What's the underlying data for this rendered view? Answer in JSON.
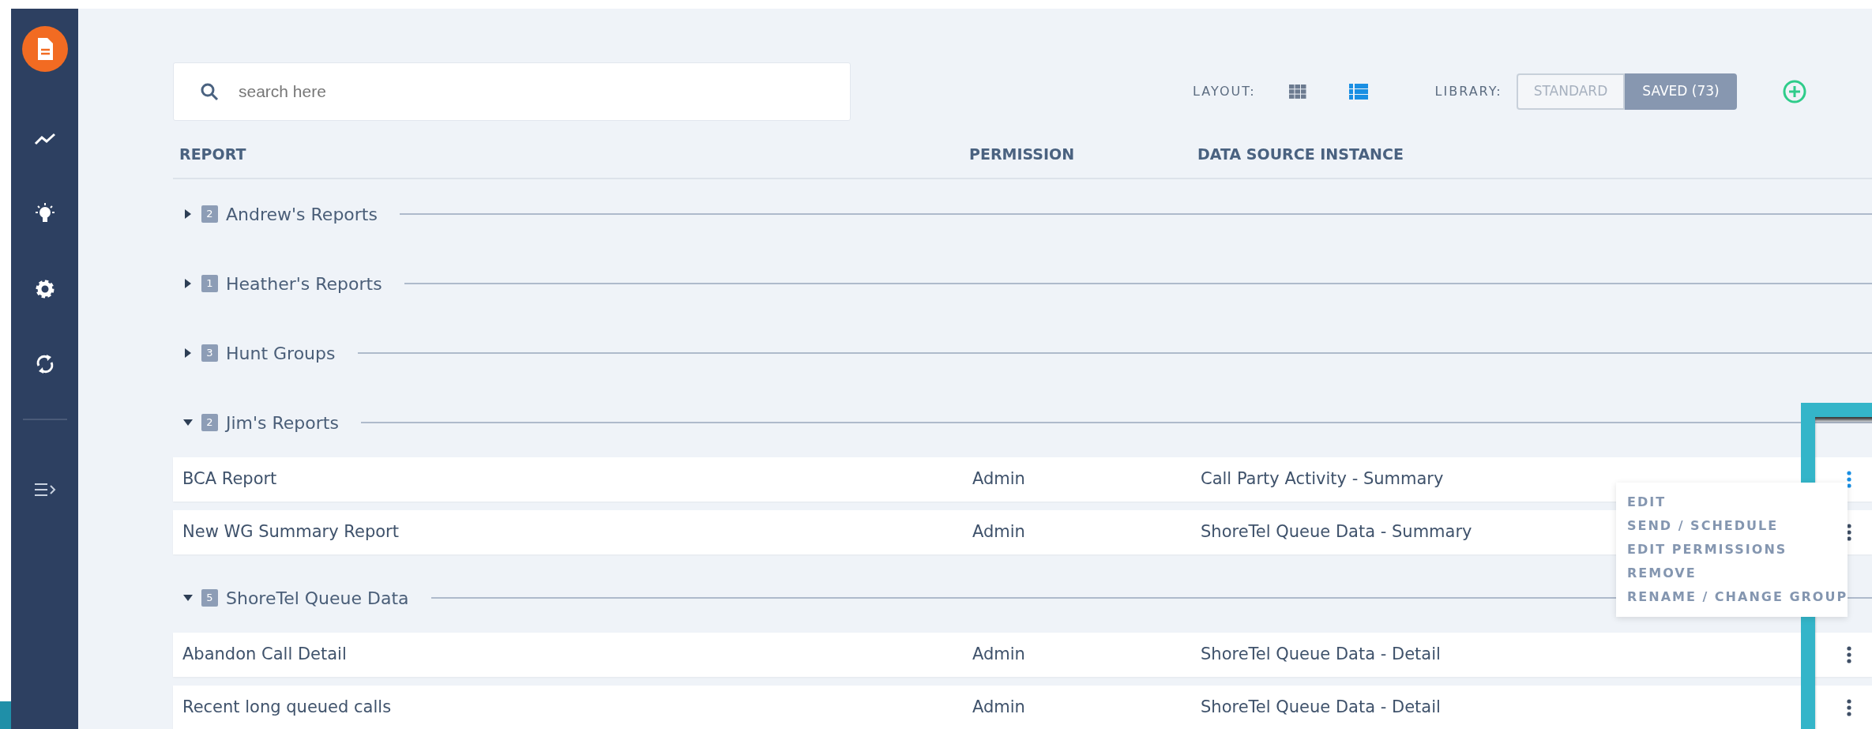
{
  "sidebar": {
    "items": [
      {
        "selected": true
      },
      {
        "selected": false
      },
      {
        "selected": false
      },
      {
        "selected": false
      },
      {
        "selected": false
      }
    ]
  },
  "search": {
    "placeholder": "search here"
  },
  "layout": {
    "label": "LAYOUT:",
    "options": [
      {
        "selected": false
      },
      {
        "selected": true
      }
    ]
  },
  "library": {
    "label": "LIBRARY:",
    "options": [
      {
        "label": "STANDARD",
        "selected": false
      },
      {
        "label": "SAVED (73)",
        "selected": true
      }
    ]
  },
  "table": {
    "columns": [
      "REPORT",
      "PERMISSION",
      "DATA SOURCE INSTANCE"
    ],
    "groups": [
      {
        "name": "Andrew's Reports",
        "count": "2",
        "expanded": false
      },
      {
        "name": "Heather's Reports",
        "count": "1",
        "expanded": false
      },
      {
        "name": "Hunt Groups",
        "count": "3",
        "expanded": false
      },
      {
        "name": "Jim's Reports",
        "count": "2",
        "expanded": true,
        "rows": [
          {
            "report": "BCA Report",
            "permission": "Admin",
            "source": "Call Party Activity - Summary",
            "menu_open": true
          },
          {
            "report": "New WG Summary Report",
            "permission": "Admin",
            "source": "ShoreTel Queue Data - Summary",
            "menu_open": false
          }
        ]
      },
      {
        "name": "ShoreTel Queue Data",
        "count": "5",
        "expanded": true,
        "rows": [
          {
            "report": "Abandon Call Detail",
            "permission": "Admin",
            "source": "ShoreTel Queue Data - Detail",
            "menu_open": false
          },
          {
            "report": "Recent long queued calls",
            "permission": "Admin",
            "source": "ShoreTel Queue Data - Detail",
            "menu_open": false
          }
        ]
      }
    ]
  },
  "row_menu": {
    "items": [
      "EDIT",
      "SEND / SCHEDULE",
      "EDIT PERMISSIONS",
      "REMOVE",
      "RENAME / CHANGE GROUP"
    ]
  }
}
